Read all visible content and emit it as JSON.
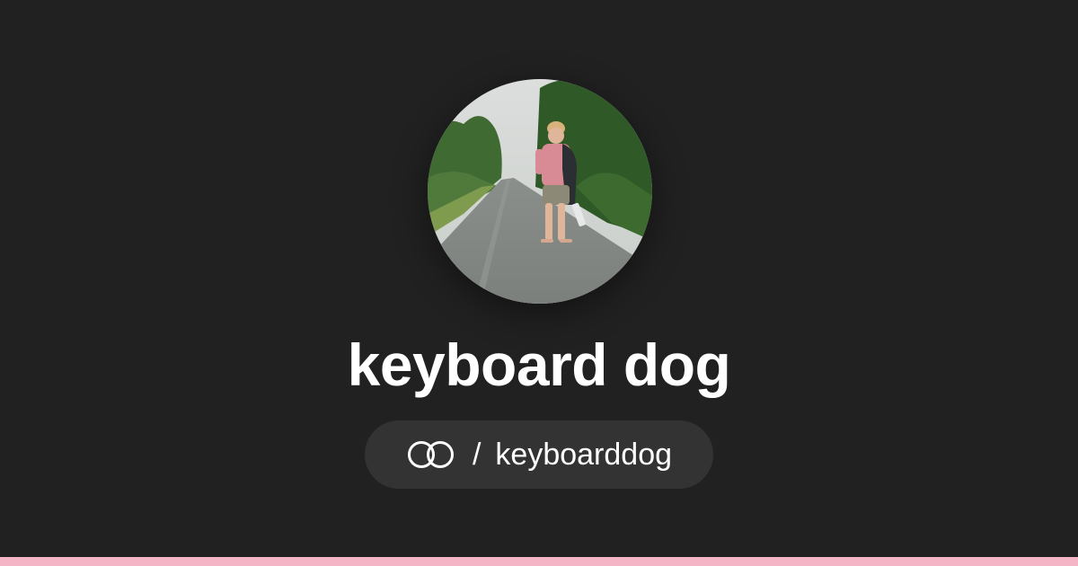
{
  "profile": {
    "display_name": "keyboard dog",
    "handle_separator": "/",
    "handle": "keyboarddog",
    "avatar_description": "person standing on a country road"
  },
  "icons": {
    "site_logo": "interlocking-rings-logo-icon"
  },
  "colors": {
    "background": "#212121",
    "pill_background": "#333333",
    "text": "#ffffff",
    "accent_strip": "#f4b6c6"
  }
}
